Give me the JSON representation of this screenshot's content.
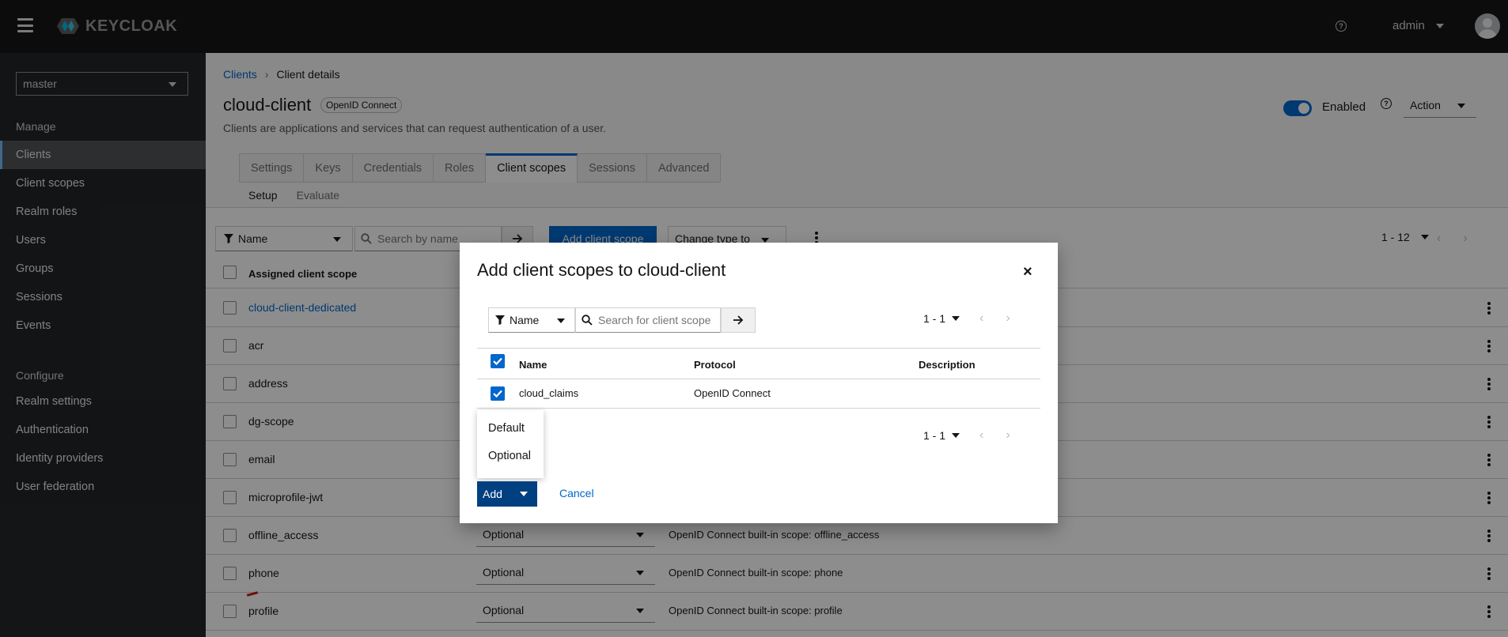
{
  "header": {
    "brand": "KEYCLOAK",
    "user": "admin"
  },
  "sidebar": {
    "realm": "master",
    "manage_heading": "Manage",
    "manage_items": [
      {
        "label": "Clients",
        "active": true
      },
      {
        "label": "Client scopes"
      },
      {
        "label": "Realm roles"
      },
      {
        "label": "Users"
      },
      {
        "label": "Groups"
      },
      {
        "label": "Sessions"
      },
      {
        "label": "Events"
      }
    ],
    "configure_heading": "Configure",
    "configure_items": [
      {
        "label": "Realm settings"
      },
      {
        "label": "Authentication"
      },
      {
        "label": "Identity providers"
      },
      {
        "label": "User federation"
      }
    ]
  },
  "page": {
    "breadcrumb_link": "Clients",
    "breadcrumb_current": "Client details",
    "title": "cloud-client",
    "protocol_badge": "OpenID Connect",
    "description": "Clients are applications and services that can request authentication of a user.",
    "enabled_label": "Enabled",
    "action_label": "Action",
    "tabs": [
      "Settings",
      "Keys",
      "Credentials",
      "Roles",
      "Client scopes",
      "Sessions",
      "Advanced"
    ],
    "active_tab": "Client scopes",
    "subtabs": [
      "Setup",
      "Evaluate"
    ]
  },
  "toolbar": {
    "filter_label": "Name",
    "search_placeholder": "Search by name",
    "add_button": "Add client scope",
    "change_type": "Change type to",
    "pagination": "1 - 12"
  },
  "table": {
    "header": "Assigned client scope",
    "rows": [
      {
        "name": "cloud-client-dedicated",
        "type": "",
        "desc": "",
        "link": true
      },
      {
        "name": "acr",
        "type": "",
        "desc": ""
      },
      {
        "name": "address",
        "type": "",
        "desc": ""
      },
      {
        "name": "dg-scope",
        "type": "",
        "desc": ""
      },
      {
        "name": "email",
        "type": "",
        "desc": ""
      },
      {
        "name": "microprofile-jwt",
        "type": "",
        "desc": ""
      },
      {
        "name": "offline_access",
        "type": "Optional",
        "desc": "OpenID Connect built-in scope: offline_access"
      },
      {
        "name": "phone",
        "type": "Optional",
        "desc": "OpenID Connect built-in scope: phone"
      },
      {
        "name": "profile",
        "type": "Optional",
        "desc": "OpenID Connect built-in scope: profile"
      }
    ]
  },
  "modal": {
    "title": "Add client scopes to cloud-client",
    "filter_label": "Name",
    "search_placeholder": "Search for client scope",
    "pagination": "1 - 1",
    "columns": {
      "name": "Name",
      "protocol": "Protocol",
      "description": "Description"
    },
    "row": {
      "name": "cloud_claims",
      "protocol": "OpenID Connect",
      "description": ""
    },
    "menu": [
      "Default",
      "Optional"
    ],
    "add_label": "Add",
    "cancel_label": "Cancel"
  },
  "colors": {
    "primary": "#0066cc",
    "masthead": "#151515",
    "sidebar": "#212427"
  }
}
